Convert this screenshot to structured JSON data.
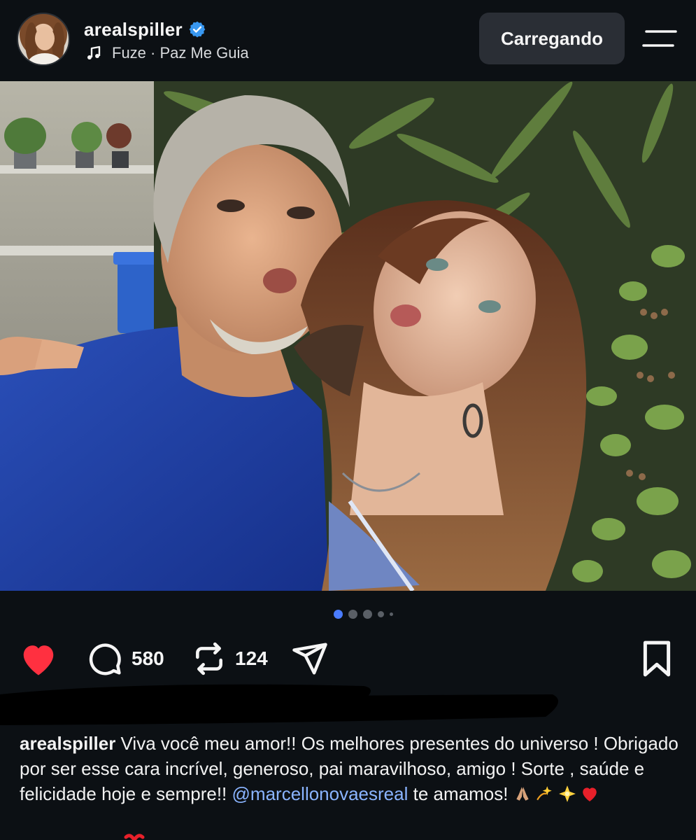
{
  "header": {
    "username": "arealspiller",
    "song": "Fuze · Paz Me Guia",
    "loading_label": "Carregando"
  },
  "icons": {
    "verified": "verified-badge-icon",
    "music": "music-note-icon",
    "menu": "menu-icon",
    "like": "heart-filled-icon",
    "comment": "comment-icon",
    "repost": "repost-icon",
    "share": "send-icon",
    "save": "bookmark-icon"
  },
  "carousel": {
    "total": 5,
    "active": 1
  },
  "actions": {
    "comments_count": "580",
    "reposts_count": "124",
    "liked": true
  },
  "caption": {
    "username": "arealspiller",
    "text": "Viva você meu amor!! Os melhores presentes do universo ! Obrigado por ser esse cara incrível, generoso, pai maravilhoso, amigo ! Sorte , saúde e felicidade hoje e sempre!!",
    "mention": "@marcellonovaesreal",
    "text_end": "te amamos!",
    "emojis": [
      "pray-emoji",
      "dizzy-emoji",
      "star-emoji",
      "red-heart-emoji"
    ]
  },
  "colors": {
    "background": "#0c1014",
    "accent_blue": "#3897f0",
    "like_red": "#ff3040",
    "mention": "#8ab4ff"
  }
}
